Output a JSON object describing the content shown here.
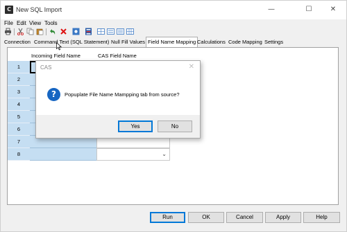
{
  "window": {
    "title": "New SQL Import",
    "icon_letter": "C",
    "controls": [
      "minimize-icon",
      "maximize-icon",
      "close-icon"
    ],
    "minimize_glyph": "—",
    "maximize_glyph": "☐",
    "close_glyph": "✕"
  },
  "menu": {
    "items": [
      "File",
      "Edit",
      "View",
      "Tools"
    ]
  },
  "toolbar": {
    "icons": [
      "print-icon",
      "cut-icon",
      "copy-icon",
      "paste-icon",
      "undo-icon",
      "delete-icon",
      "settings-icon",
      "database-icon",
      "grid-view-icon",
      "form-view-icon",
      "list-view-icon",
      "table-view-icon"
    ]
  },
  "tabs": {
    "items": [
      "Connection",
      "Command Text (SQL Statement)",
      "Null Fill Values",
      "Field Name Mapping",
      "Calculations",
      "Code Mapping",
      "Settings"
    ],
    "active": "Field Name Mapping"
  },
  "grid": {
    "columns": [
      "Incoming Field Name",
      "CAS Field Name"
    ],
    "rows": [
      "1",
      "2",
      "3",
      "4",
      "5",
      "6",
      "7",
      "8"
    ]
  },
  "buttons": {
    "run": "Run",
    "ok": "OK",
    "cancel": "Cancel",
    "apply": "Apply",
    "help": "Help"
  },
  "dialog": {
    "title": "CAS",
    "close_glyph": "✕",
    "icon_glyph": "?",
    "message": "Popuplate File Name Mampping tab from source?",
    "yes": "Yes",
    "no": "No"
  },
  "colors": {
    "accent": "#0078d7",
    "selection": "#c5def2",
    "question_icon": "#1766c2"
  }
}
